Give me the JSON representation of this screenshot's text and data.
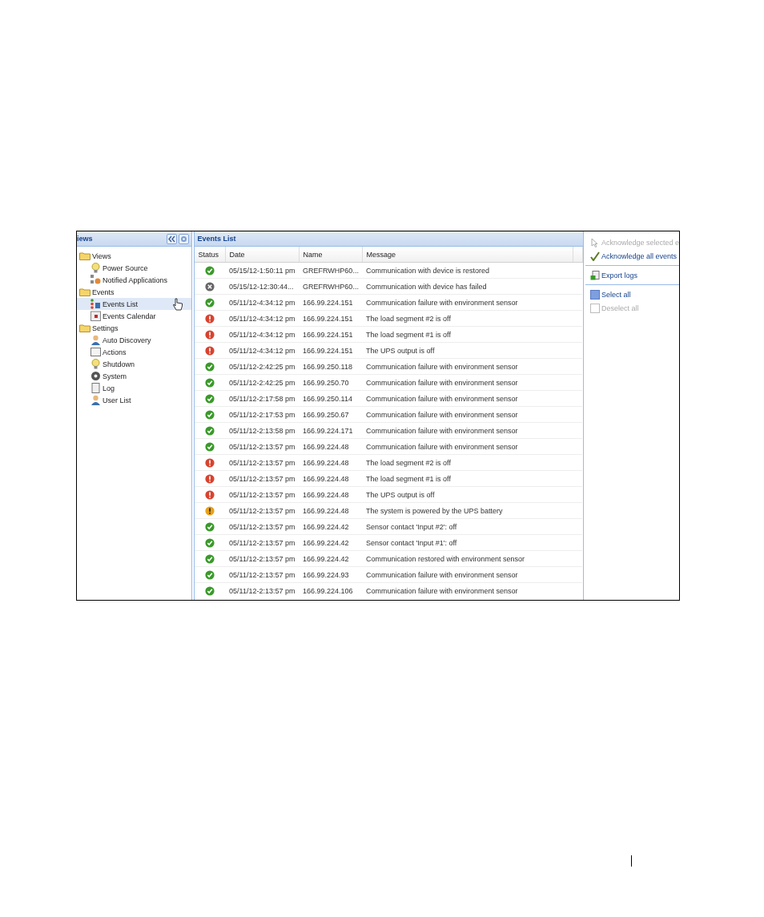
{
  "sidebar": {
    "title": "iews",
    "tree": [
      {
        "label": "Views",
        "kind": "folder",
        "selected": false,
        "children": [
          {
            "label": "Power Source",
            "kind": "bulb",
            "selected": false
          },
          {
            "label": "Notified Applications",
            "kind": "apps",
            "selected": false
          }
        ]
      },
      {
        "label": "Events",
        "kind": "folder",
        "selected": false,
        "children": [
          {
            "label": "Events List",
            "kind": "list",
            "selected": true
          },
          {
            "label": "Events Calendar",
            "kind": "calendar",
            "selected": false
          }
        ]
      },
      {
        "label": "Settings",
        "kind": "folder",
        "selected": false,
        "children": [
          {
            "label": "Auto Discovery",
            "kind": "user",
            "selected": false
          },
          {
            "label": "Actions",
            "kind": "window",
            "selected": false
          },
          {
            "label": "Shutdown",
            "kind": "bulb",
            "selected": false
          },
          {
            "label": "System",
            "kind": "gear",
            "selected": false
          },
          {
            "label": "Log",
            "kind": "page",
            "selected": false
          },
          {
            "label": "User List",
            "kind": "user",
            "selected": false
          }
        ]
      }
    ]
  },
  "events_list": {
    "title": "Events List",
    "columns": [
      "Status",
      "Date",
      "Name",
      "Message"
    ],
    "rows": [
      {
        "kind": "ok",
        "date": "05/15/12-1:50:11 pm",
        "name": "GREFRWHP60...",
        "message": "Communication with device is restored"
      },
      {
        "kind": "lost",
        "date": "05/15/12-12:30:44...",
        "name": "GREFRWHP60...",
        "message": "Communication with device has failed"
      },
      {
        "kind": "ok",
        "date": "05/11/12-4:34:12 pm",
        "name": "166.99.224.151",
        "message": "Communication failure with environment sensor"
      },
      {
        "kind": "alarm",
        "date": "05/11/12-4:34:12 pm",
        "name": "166.99.224.151",
        "message": "The load segment #2 is off"
      },
      {
        "kind": "alarm",
        "date": "05/11/12-4:34:12 pm",
        "name": "166.99.224.151",
        "message": "The load segment #1 is off"
      },
      {
        "kind": "alarm",
        "date": "05/11/12-4:34:12 pm",
        "name": "166.99.224.151",
        "message": "The UPS output is off"
      },
      {
        "kind": "ok",
        "date": "05/11/12-2:42:25 pm",
        "name": "166.99.250.118",
        "message": "Communication failure with environment sensor"
      },
      {
        "kind": "ok",
        "date": "05/11/12-2:42:25 pm",
        "name": "166.99.250.70",
        "message": "Communication failure with environment sensor"
      },
      {
        "kind": "ok",
        "date": "05/11/12-2:17:58 pm",
        "name": "166.99.250.114",
        "message": "Communication failure with environment sensor"
      },
      {
        "kind": "ok",
        "date": "05/11/12-2:17:53 pm",
        "name": "166.99.250.67",
        "message": "Communication failure with environment sensor"
      },
      {
        "kind": "ok",
        "date": "05/11/12-2:13:58 pm",
        "name": "166.99.224.171",
        "message": "Communication failure with environment sensor"
      },
      {
        "kind": "ok",
        "date": "05/11/12-2:13:57 pm",
        "name": "166.99.224.48",
        "message": "Communication failure with environment sensor"
      },
      {
        "kind": "alarm",
        "date": "05/11/12-2:13:57 pm",
        "name": "166.99.224.48",
        "message": "The load segment #2 is off"
      },
      {
        "kind": "alarm",
        "date": "05/11/12-2:13:57 pm",
        "name": "166.99.224.48",
        "message": "The load segment #1 is off"
      },
      {
        "kind": "alarm",
        "date": "05/11/12-2:13:57 pm",
        "name": "166.99.224.48",
        "message": "The UPS output is off"
      },
      {
        "kind": "warning",
        "date": "05/11/12-2:13:57 pm",
        "name": "166.99.224.48",
        "message": "The system is powered by the UPS battery"
      },
      {
        "kind": "ok",
        "date": "05/11/12-2:13:57 pm",
        "name": "166.99.224.42",
        "message": "Sensor contact 'Input #2': off"
      },
      {
        "kind": "ok",
        "date": "05/11/12-2:13:57 pm",
        "name": "166.99.224.42",
        "message": "Sensor contact 'Input #1': off"
      },
      {
        "kind": "ok",
        "date": "05/11/12-2:13:57 pm",
        "name": "166.99.224.42",
        "message": "Communication restored with environment sensor"
      },
      {
        "kind": "ok",
        "date": "05/11/12-2:13:57 pm",
        "name": "166.99.224.93",
        "message": "Communication failure with environment sensor"
      },
      {
        "kind": "ok",
        "date": "05/11/12-2:13:57 pm",
        "name": "166.99.224.106",
        "message": "Communication failure with environment sensor"
      }
    ]
  },
  "actions": [
    {
      "label": "Acknowledge selected e",
      "kind": "pointer",
      "disabled": true,
      "divider_after": false
    },
    {
      "label": "Acknowledge all events",
      "kind": "tick",
      "disabled": false,
      "divider_after": true
    },
    {
      "label": "Export logs",
      "kind": "export",
      "disabled": false,
      "divider_after": true
    },
    {
      "label": "Select all",
      "kind": "filled-box",
      "disabled": false,
      "divider_after": false
    },
    {
      "label": "Deselect all",
      "kind": "empty-box",
      "disabled": true,
      "divider_after": false
    }
  ]
}
